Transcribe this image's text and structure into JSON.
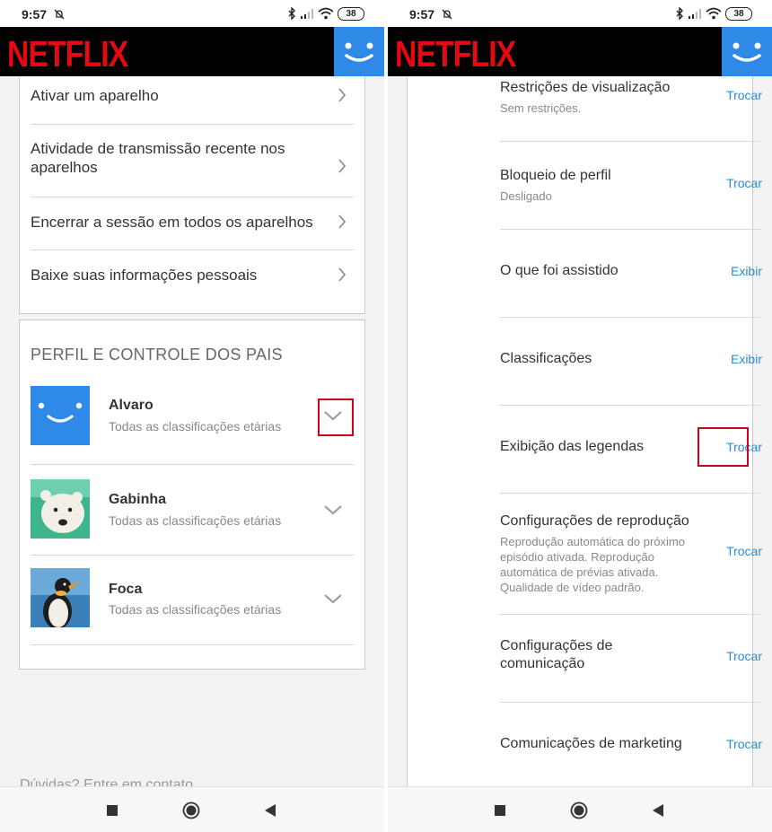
{
  "status_bar": {
    "time": "9:57",
    "battery": "38"
  },
  "app": {
    "brand": "NETFLIX"
  },
  "left_panel": {
    "account_items": [
      {
        "label": "Ativar um aparelho"
      },
      {
        "label": "Atividade de transmissão recente nos aparelhos"
      },
      {
        "label": "Encerrar a sessão em todos os aparelhos"
      },
      {
        "label": "Baixe suas informações pessoais"
      }
    ],
    "profile_section_title": "PERFIL E CONTROLE DOS PAIS",
    "profiles": [
      {
        "name": "Alvaro",
        "rating": "Todas as classificações etárias",
        "avatar": "smiley-blue"
      },
      {
        "name": "Gabinha",
        "rating": "Todas as classificações etárias",
        "avatar": "polar-bear"
      },
      {
        "name": "Foca",
        "rating": "Todas as classificações etárias",
        "avatar": "penguin"
      }
    ],
    "footer_text": "Dúvidas? Entre em contato"
  },
  "right_panel": {
    "settings": [
      {
        "title": "Restrições de visualização",
        "subtitle": "Sem restrições.",
        "action": "Trocar"
      },
      {
        "title": "Bloqueio de perfil",
        "subtitle": "Desligado",
        "action": "Trocar"
      },
      {
        "title": "O que foi assistido",
        "subtitle": "",
        "action": "Exibir"
      },
      {
        "title": "Classificações",
        "subtitle": "",
        "action": "Exibir"
      },
      {
        "title": "Exibição das legendas",
        "subtitle": "",
        "action": "Trocar"
      },
      {
        "title": "Configurações de reprodução",
        "subtitle": "Reprodução automática do próximo episódio ativada. Reprodução automática de prévias ativada. Qualidade de vídeo padrão.",
        "action": "Trocar"
      },
      {
        "title": "Configurações de comunicação",
        "subtitle": "",
        "action": "Trocar"
      },
      {
        "title": "Comunicações de marketing",
        "subtitle": "",
        "action": "Trocar"
      }
    ]
  },
  "colors": {
    "brand_red": "#e50914",
    "link_blue": "#2c8ccf",
    "highlight_red": "#d0021b",
    "avatar_blue": "#2e8ae6"
  },
  "icons": [
    "chevron-right-icon",
    "chevron-down-icon",
    "bluetooth-icon",
    "signal-icon",
    "wifi-icon",
    "battery-icon",
    "mute-icon",
    "stop-icon",
    "home-icon",
    "back-icon"
  ]
}
